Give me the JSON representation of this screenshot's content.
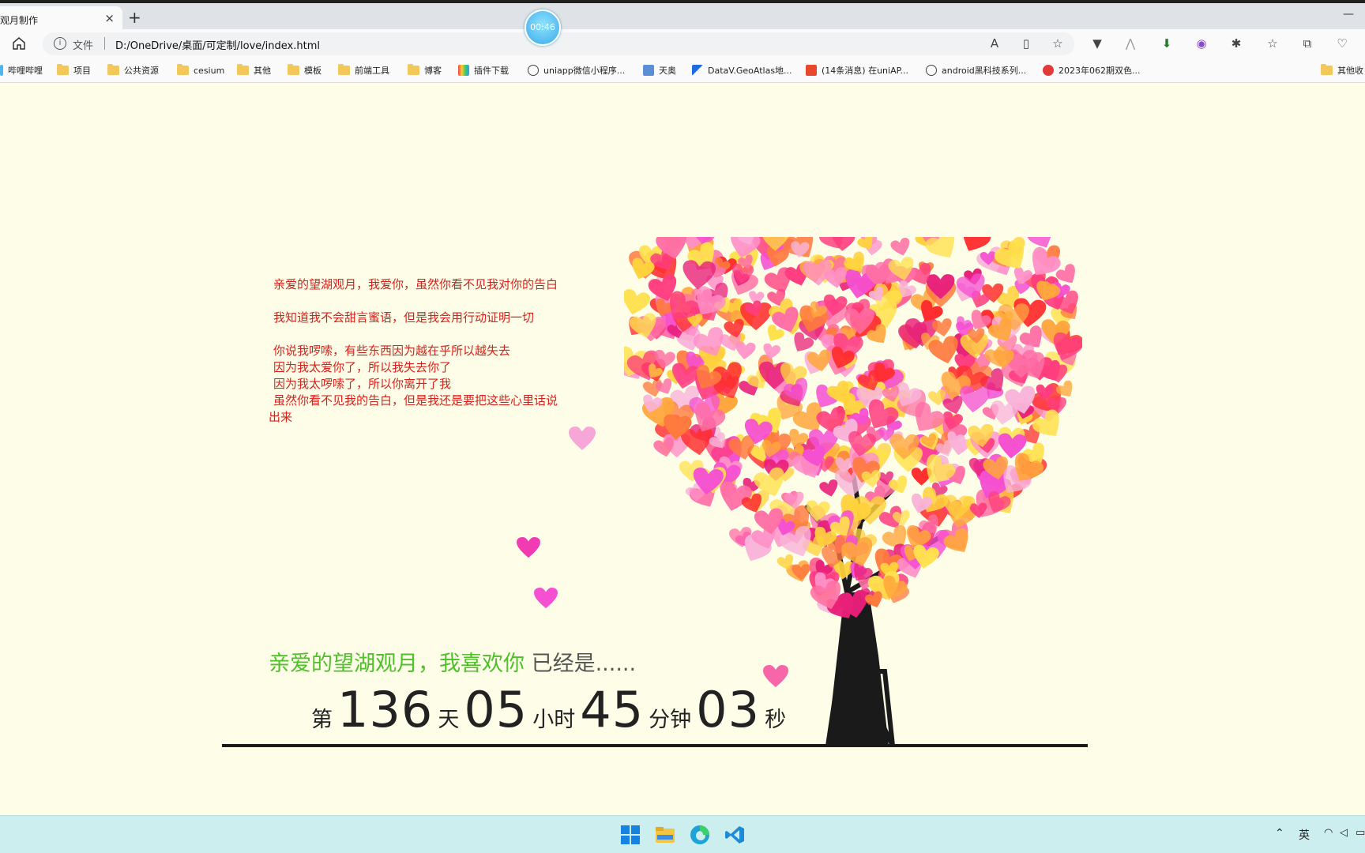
{
  "browser": {
    "tab_title": "观月制作",
    "tab_close": "×",
    "new_tab": "+",
    "minimize": "—",
    "address_label": "文件",
    "url": "D:/OneDrive/桌面/可定制/love/index.html",
    "timer": "00:46"
  },
  "bookmarks": [
    {
      "label": "哔哩哔哩",
      "icon": "bilibili-icon"
    },
    {
      "label": "项目",
      "icon": "folder-icon"
    },
    {
      "label": "公共资源",
      "icon": "folder-icon"
    },
    {
      "label": "cesium",
      "icon": "folder-icon"
    },
    {
      "label": "其他",
      "icon": "folder-icon"
    },
    {
      "label": "模板",
      "icon": "folder-icon"
    },
    {
      "label": "前端工具",
      "icon": "folder-icon"
    },
    {
      "label": "博客",
      "icon": "folder-icon"
    },
    {
      "label": "插件下载",
      "icon": "rainbow-icon"
    },
    {
      "label": "uniapp微信小程序...",
      "icon": "uniapp-icon"
    },
    {
      "label": "天奥",
      "icon": "tianao-icon"
    },
    {
      "label": "DataV.GeoAtlas地...",
      "icon": "datav-icon"
    },
    {
      "label": "(14条消息) 在uniAP...",
      "icon": "csdn-icon"
    },
    {
      "label": "android黑科技系列...",
      "icon": "uniapp-icon"
    },
    {
      "label": "2023年062期双色...",
      "icon": "lottery-icon"
    },
    {
      "label": "其他收",
      "icon": "folder-icon"
    }
  ],
  "letter": {
    "line1": "亲爱的望湖观月，我爱你，虽然你看不见我对你的告白",
    "line2": "我知道我不会甜言蜜语，但是我会用行动证明一切",
    "line3": "你说我啰嗦，有些东西因为越在乎所以越失去",
    "line4": "因为我太爱你了，所以我失去你了",
    "line5": "因为我太啰嗦了，所以你离开了我",
    "line6": "虽然你看不见我的告白，但是我还是要把这些心里话说",
    "line7": "出来"
  },
  "title": {
    "green": "亲爱的望湖观月，我喜欢你",
    "gray": "已经是......"
  },
  "counter": {
    "prefix": "第",
    "days": "136",
    "days_unit": "天",
    "hours": "05",
    "hours_unit": "小时",
    "minutes": "45",
    "minutes_unit": "分钟",
    "seconds": "03",
    "seconds_unit": "秒"
  },
  "taskbar": {
    "ime": "英"
  },
  "colors": {
    "page_bg": "#fdfde8",
    "letter_red": "#d8211c",
    "title_green": "#4fbf2a",
    "taskbar_bg": "#cdeeee"
  }
}
